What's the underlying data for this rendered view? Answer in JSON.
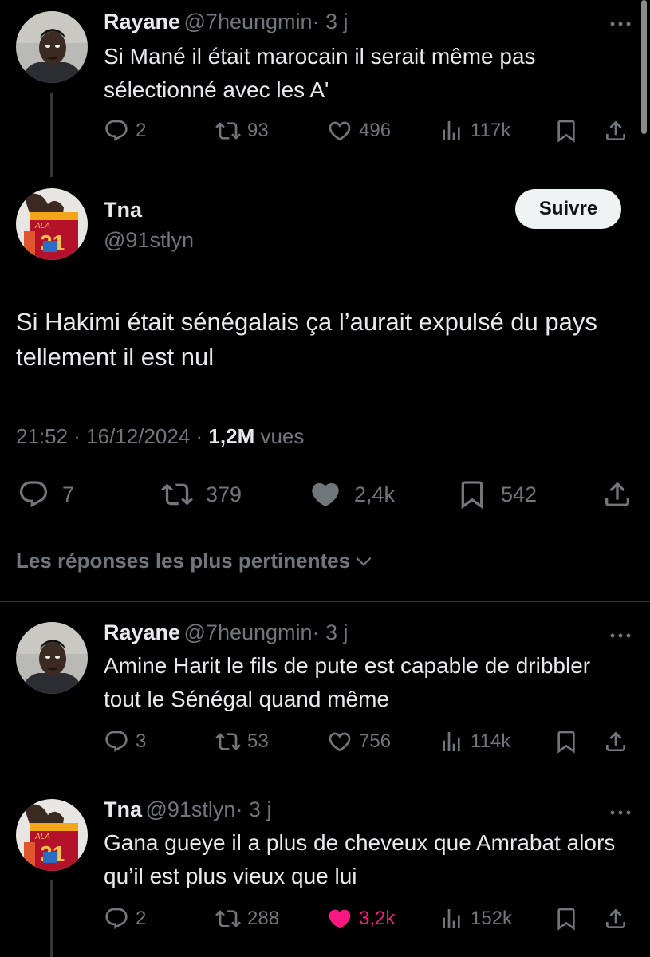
{
  "tweets": [
    {
      "name": "Rayane",
      "handle": "@7heungmin",
      "time": "· 3 j",
      "text": "Si Mané il était marocain il serait même pas sélectionné avec les A'",
      "replies": "2",
      "retweets": "93",
      "likes": "496",
      "views": "117k",
      "liked": false
    }
  ],
  "main": {
    "name": "Tna",
    "handle": "@91stlyn",
    "follow_label": "Suivre",
    "text": "Si Hakimi était sénégalais ça l’aurait expulsé du pays tellement il est nul",
    "timestamp": "21:52 · 16/12/2024 ·",
    "views_count": "1,2M",
    "views_label": "vues",
    "replies": "7",
    "retweets": "379",
    "likes": "2,4k",
    "bookmarks": "542",
    "liked": true
  },
  "sort_label": "Les réponses les plus pertinentes",
  "replies": [
    {
      "name": "Rayane",
      "handle": "@7heungmin",
      "time": "· 3 j",
      "text": "Amine Harit le fils de pute est capable de dribbler tout le Sénégal quand même",
      "replies": "3",
      "retweets": "53",
      "likes": "756",
      "views": "114k",
      "liked": false
    },
    {
      "name": "Tna",
      "handle": "@91stlyn",
      "time": "· 3 j",
      "text": "Gana gueye il a plus de cheveux que Amrabat alors qu’il est plus vieux que lui",
      "replies": "2",
      "retweets": "288",
      "likes": "3,2k",
      "views": "152k",
      "liked": true
    }
  ],
  "colors": {
    "background": "#000000",
    "text": "#e7e9ea",
    "muted": "#71767b",
    "like": "#f91880",
    "divider": "#2f3336"
  },
  "icons": [
    "reply-icon",
    "retweet-icon",
    "heart-icon",
    "views-icon",
    "bookmark-icon",
    "share-icon",
    "more-icon",
    "chevron-down-icon"
  ]
}
